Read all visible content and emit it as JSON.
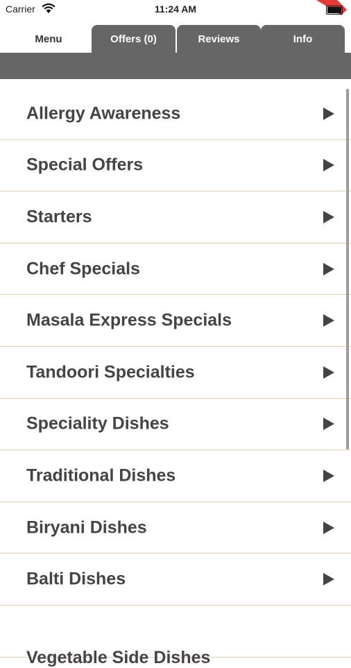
{
  "status_bar": {
    "carrier": "Carrier",
    "time": "11:24 AM"
  },
  "tabs": [
    {
      "label": "Menu",
      "active": true
    },
    {
      "label": "Offers (0)",
      "active": false
    },
    {
      "label": "Reviews",
      "active": false
    },
    {
      "label": "Info",
      "active": false
    }
  ],
  "menu": {
    "items": [
      {
        "label": "Allergy Awareness"
      },
      {
        "label": "Special Offers"
      },
      {
        "label": "Starters"
      },
      {
        "label": "Chef Specials"
      },
      {
        "label": "Masala Express Specials"
      },
      {
        "label": "Tandoori Specialties"
      },
      {
        "label": "Speciality Dishes"
      },
      {
        "label": "Traditional Dishes"
      },
      {
        "label": "Biryani Dishes"
      },
      {
        "label": "Balti Dishes"
      },
      {
        "label": "Vegetable Side Dishes"
      }
    ]
  },
  "colors": {
    "tab_inactive": "#666666",
    "divider": "#f3c9a0",
    "text": "#444444",
    "accent_flag": "#e53935"
  }
}
